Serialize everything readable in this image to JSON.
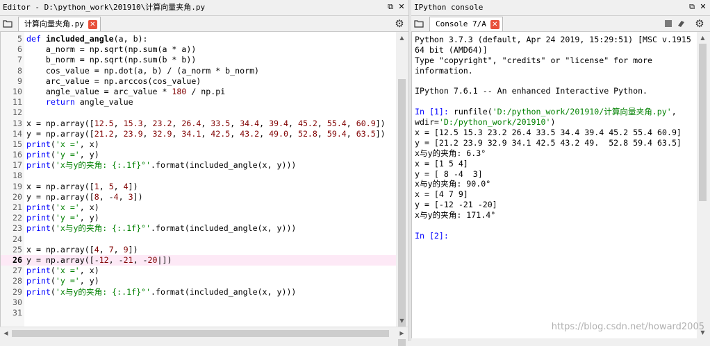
{
  "editor": {
    "title": "Editor - D:\\python_work\\201910\\计算向量夹角.py",
    "tab_label": "计算向量夹角.py",
    "lines": [
      {
        "n": "5",
        "html": "<span class=\"kw\">def</span> <span class=\"fn\">included_angle</span>(a, b):"
      },
      {
        "n": "6",
        "html": "    a_norm = np.sqrt(np.sum(a * a))"
      },
      {
        "n": "7",
        "html": "    b_norm = np.sqrt(np.sum(b * b))"
      },
      {
        "n": "8",
        "html": "    cos_value = np.dot(a, b) / (a_norm * b_norm)"
      },
      {
        "n": "9",
        "html": "    arc_value = np.arccos(cos_value)"
      },
      {
        "n": "10",
        "html": "    angle_value = arc_value * <span class=\"num\">180</span> / np.pi"
      },
      {
        "n": "11",
        "html": "    <span class=\"kw\">return</span> angle_value"
      },
      {
        "n": "12",
        "html": ""
      },
      {
        "n": "13",
        "html": "x = np.array([<span class=\"num\">12.5</span>, <span class=\"num\">15.3</span>, <span class=\"num\">23.2</span>, <span class=\"num\">26.4</span>, <span class=\"num\">33.5</span>, <span class=\"num\">34.4</span>, <span class=\"num\">39.4</span>, <span class=\"num\">45.2</span>, <span class=\"num\">55.4</span>, <span class=\"num\">60.9</span>])"
      },
      {
        "n": "14",
        "html": "y = np.array([<span class=\"num\">21.2</span>, <span class=\"num\">23.9</span>, <span class=\"num\">32.9</span>, <span class=\"num\">34.1</span>, <span class=\"num\">42.5</span>, <span class=\"num\">43.2</span>, <span class=\"num\">49.0</span>, <span class=\"num\">52.8</span>, <span class=\"num\">59.4</span>, <span class=\"num\">63.5</span>])"
      },
      {
        "n": "15",
        "html": "<span class=\"kw\">print</span>(<span class=\"str\">'x ='</span>, x)"
      },
      {
        "n": "16",
        "html": "<span class=\"kw\">print</span>(<span class=\"str\">'y ='</span>, y)"
      },
      {
        "n": "17",
        "html": "<span class=\"kw\">print</span>(<span class=\"str\">'x与y的夹角: {:.1f}°'</span>.format(included_angle(x, y)))"
      },
      {
        "n": "18",
        "html": ""
      },
      {
        "n": "19",
        "html": "x = np.array([<span class=\"num\">1</span>, <span class=\"num\">5</span>, <span class=\"num\">4</span>])"
      },
      {
        "n": "20",
        "html": "y = np.array([<span class=\"num\">8</span>, -<span class=\"num\">4</span>, <span class=\"num\">3</span>])"
      },
      {
        "n": "21",
        "html": "<span class=\"kw\">print</span>(<span class=\"str\">'x ='</span>, x)"
      },
      {
        "n": "22",
        "html": "<span class=\"kw\">print</span>(<span class=\"str\">'y ='</span>, y)"
      },
      {
        "n": "23",
        "html": "<span class=\"kw\">print</span>(<span class=\"str\">'x与y的夹角: {:.1f}°'</span>.format(included_angle(x, y)))"
      },
      {
        "n": "24",
        "html": ""
      },
      {
        "n": "25",
        "html": "x = np.array([<span class=\"num\">4</span>, <span class=\"num\">7</span>, <span class=\"num\">9</span>])"
      },
      {
        "n": "26",
        "html": "y = np.array([-<span class=\"num\">12</span>, -<span class=\"num\">21</span>, -<span class=\"num\">20</span>|])",
        "active": true
      },
      {
        "n": "27",
        "html": "<span class=\"kw\">print</span>(<span class=\"str\">'x ='</span>, x)"
      },
      {
        "n": "28",
        "html": "<span class=\"kw\">print</span>(<span class=\"str\">'y ='</span>, y)"
      },
      {
        "n": "29",
        "html": "<span class=\"kw\">print</span>(<span class=\"str\">'x与y的夹角: {:.1f}°'</span>.format(included_angle(x, y)))"
      },
      {
        "n": "30",
        "html": ""
      },
      {
        "n": "31",
        "html": ""
      }
    ]
  },
  "console": {
    "title": "IPython console",
    "tab_label": "Console 7/A",
    "lines": [
      {
        "html": "Python 3.7.3 (default, Apr 24 2019, 15:29:51) [MSC v.1915"
      },
      {
        "html": "64 bit (AMD64)]"
      },
      {
        "html": "Type \"copyright\", \"credits\" or \"license\" for more"
      },
      {
        "html": "information."
      },
      {
        "html": ""
      },
      {
        "html": "IPython 7.6.1 -- An enhanced Interactive Python."
      },
      {
        "html": ""
      },
      {
        "html": "<span class=\"prompt\">In [1]:</span> runfile(<span class=\"cstr\">'D:/python_work/201910/计算向量夹角.py'</span>,"
      },
      {
        "html": "wdir=<span class=\"cstr\">'D:/python_work/201910'</span>)"
      },
      {
        "html": "x = [12.5 15.3 23.2 26.4 33.5 34.4 39.4 45.2 55.4 60.9]"
      },
      {
        "html": "y = [21.2 23.9 32.9 34.1 42.5 43.2 49.  52.8 59.4 63.5]"
      },
      {
        "html": "x与y的夹角: 6.3°"
      },
      {
        "html": "x = [1 5 4]"
      },
      {
        "html": "y = [ 8 -4  3]"
      },
      {
        "html": "x与y的夹角: 90.0°"
      },
      {
        "html": "x = [4 7 9]"
      },
      {
        "html": "y = [-12 -21 -20]"
      },
      {
        "html": "x与y的夹角: 171.4°"
      },
      {
        "html": ""
      },
      {
        "html": "<span class=\"prompt\">In [2]:</span>"
      }
    ]
  },
  "watermark": "https://blog.csdn.net/howard2005",
  "icons": {
    "folder": "folder-icon",
    "options": "gear-icon",
    "undock": "undock-icon",
    "close": "close-icon",
    "stop": "stop-icon",
    "clear": "eraser-icon"
  }
}
